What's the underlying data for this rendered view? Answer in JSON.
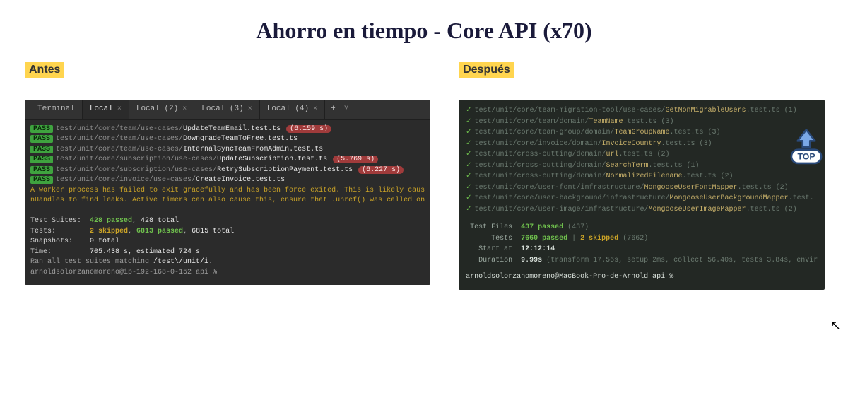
{
  "title": "Ahorro en tiempo - Core API (x70)",
  "labels": {
    "antes": "Antes",
    "despues": "Después"
  },
  "top_badge": {
    "text": "TOP"
  },
  "colors": {
    "highlight": "#ffd54f",
    "pass": "#3fa33f",
    "warn": "#c9a227",
    "time": "#a03b3b",
    "accent_green": "#6fbf4d"
  },
  "left": {
    "tabs": {
      "main": "Terminal",
      "active": "Local",
      "t2": "Local (2)",
      "t3": "Local (3)",
      "t4": "Local (4)"
    },
    "lines": [
      {
        "path": "test/unit/core/team/use-cases/",
        "file": "UpdateTeamEmail.test.ts",
        "time": "(6.159 s)"
      },
      {
        "path": "test/unit/core/team/use-cases/",
        "file": "DowngradeTeamToFree.test.ts",
        "time": ""
      },
      {
        "path": "test/unit/core/team/use-cases/",
        "file": "InternalSyncTeamFromAdmin.test.ts",
        "time": ""
      },
      {
        "path": "test/unit/core/subscription/use-cases/",
        "file": "UpdateSubscription.test.ts",
        "time": "(5.769 s)"
      },
      {
        "path": "test/unit/core/subscription/use-cases/",
        "file": "RetrySubscriptionPayment.test.ts",
        "time": "(6.227 s)"
      },
      {
        "path": "test/unit/core/invoice/use-cases/",
        "file": "CreateInvoice.test.ts",
        "time": ""
      }
    ],
    "badge": "PASS",
    "warn1": "A worker process has failed to exit gracefully and has been force exited. This is likely caus",
    "warn2": "nHandles to find leaks. Active timers can also cause this, ensure that .unref() was called on",
    "summary": {
      "suites_label": "Test Suites:",
      "suites_passed": "428 passed",
      "suites_total": "428 total",
      "tests_label": "Tests:",
      "tests_skipped": "2 skipped",
      "tests_passed": "6813 passed",
      "tests_total": "6815 total",
      "snapshots_label": "Snapshots:",
      "snapshots_val": "0 total",
      "time_label": "Time:",
      "time_val": "705.438 s, estimated 724 s",
      "ran": "Ran all test suites matching ",
      "ran_pattern": "/test\\/unit/i",
      "prompt": "arnoldsolorzanomoreno@ip-192-168-0-152 api %"
    }
  },
  "right": {
    "lines": [
      {
        "path": "test/unit/core/team-migration-tool/use-cases/",
        "file": "GetNonMigrableUsers",
        "ext": ".test.ts (1)"
      },
      {
        "path": "test/unit/core/team/domain/",
        "file": "TeamName",
        "ext": ".test.ts (3)"
      },
      {
        "path": "test/unit/core/team-group/domain/",
        "file": "TeamGroupName",
        "ext": ".test.ts (3)"
      },
      {
        "path": "test/unit/core/invoice/domain/",
        "file": "InvoiceCountry",
        "ext": ".test.ts (3)"
      },
      {
        "path": "test/unit/cross-cutting/domain/",
        "file": "url",
        "ext": ".test.ts (2)"
      },
      {
        "path": "test/unit/cross-cutting/domain/",
        "file": "SearchTerm",
        "ext": ".test.ts (1)"
      },
      {
        "path": "test/unit/cross-cutting/domain/",
        "file": "NormalizedFilename",
        "ext": ".test.ts (2)"
      },
      {
        "path": "test/unit/core/user-font/infrastructure/",
        "file": "MongooseUserFontMapper",
        "ext": ".test.ts (2)"
      },
      {
        "path": "test/unit/core/user-background/infrastructure/",
        "file": "MongooseUserBackgroundMapper",
        "ext": ".test."
      },
      {
        "path": "test/unit/core/user-image/infrastructure/",
        "file": "MongooseUserImageMapper",
        "ext": ".test.ts (2)"
      }
    ],
    "summary": {
      "files_label": "Test Files",
      "files_passed": "437 passed",
      "files_total": "(437)",
      "tests_label": "Tests",
      "tests_passed": "7660 passed",
      "tests_skipped": "2 skipped",
      "tests_total": "(7662)",
      "start_label": "Start at",
      "start_val": "12:12:14",
      "dur_label": "Duration",
      "dur_val": "9.99s",
      "dur_extra": "(transform 17.56s, setup 2ms, collect 56.40s, tests 3.84s, envir",
      "prompt": "arnoldsolorzanomoreno@MacBook-Pro-de-Arnold api %"
    }
  }
}
